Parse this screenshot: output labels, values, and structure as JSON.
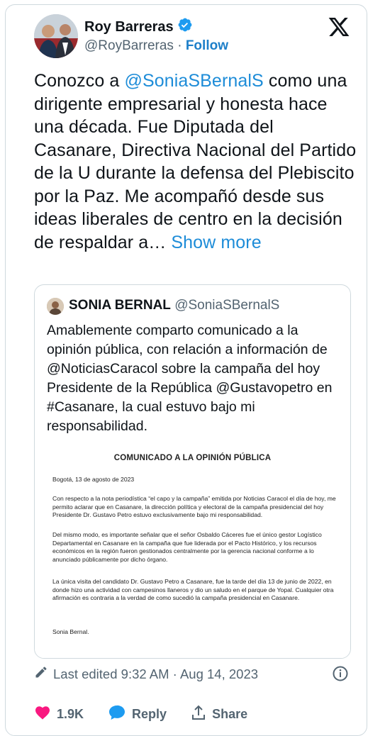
{
  "author": {
    "name": "Roy Barreras",
    "handle": "@RoyBarreras",
    "separator": "·",
    "follow_label": "Follow"
  },
  "tweet": {
    "text_before": "Conozco a ",
    "mention": "@SoniaSBernalS",
    "text_after": " como una dirigente empresarial y honesta hace una década. Fue Diputada del Casanare, Directiva Nacional del Partido de la U durante la defensa del Plebiscito por la Paz. Me acompañó desde sus ideas liberales de centro en la decisión de respaldar a… ",
    "show_more": "Show more"
  },
  "quote": {
    "name": "SONIA BERNAL",
    "handle": "@SoniaSBernalS",
    "text": "Amablemente comparto comunicado a la opinión  pública, con relación a información de @NoticiasCaracol sobre la campaña del hoy Presidente de la República @Gustavopetro en #Casanare, la cual estuvo bajo mi responsabilidad."
  },
  "document": {
    "title": "COMUNICADO A LA OPINIÓN PÚBLICA",
    "date": "Bogotá, 13 de agosto de 2023",
    "p1": "Con respecto a la nota periodística “el capo y la campaña” emitida por Noticias Caracol el día de hoy, me permito aclarar que en Casanare, la dirección política y electoral de la campaña presidencial del hoy Presidente Dr. Gustavo Petro estuvo exclusivamente bajo mi responsabilidad.",
    "p2": "Del mismo modo, es importante señalar que el señor Osbaldo Cáceres fue el único gestor Logístico Departamental en Casanare en la campaña que fue liderada por el Pacto Histórico, y los recursos económicos en la región fueron gestionados centralmente por la gerencia nacional conforme a lo anunciado públicamente por dicho órgano.",
    "p3": "La única visita del candidato Dr. Gustavo Petro a Casanare, fue la tarde del día 13 de junio de 2022, en donde hizo una actividad con campesinos llaneros y dio un saludo en el parque de Yopal. Cualquier otra afirmación es contraria a la verdad de como sucedió la campaña presidencial en Casanare.",
    "signature": "Sonia Bernal."
  },
  "meta": {
    "edited": "Last edited 9:32 AM · Aug 14, 2023"
  },
  "actions": {
    "likes": "1.9K",
    "reply_label": "Reply",
    "share_label": "Share"
  },
  "colors": {
    "accent": "#1d9bf0",
    "like": "#f91880",
    "muted": "#536471"
  },
  "icons": [
    "verified-badge-icon",
    "x-logo-icon",
    "pencil-icon",
    "info-icon",
    "heart-icon",
    "reply-icon",
    "share-icon"
  ]
}
